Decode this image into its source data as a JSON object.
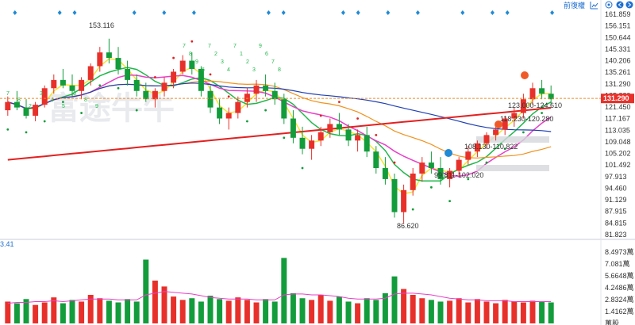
{
  "toolbar": {
    "label": "前復權",
    "icons": [
      "line-chart-icon",
      "gear-icon",
      "prev-icon",
      "next-icon"
    ]
  },
  "colors": {
    "up": "#e8302a",
    "down": "#139c3b",
    "ma_short": "#f5e52c",
    "ma_mid": "#1fb84a",
    "ma_magenta": "#e83fc8",
    "ma_orange": "#f0921e",
    "ma_blue": "#1f3fb3",
    "ma_red_long": "#e32020",
    "sar": "#e32020",
    "sar_low": "#139c3b",
    "price_line": "#f08a24",
    "price_tag": "#e8302a",
    "event_diamond": "#1f8ad6"
  },
  "watermark": "富途牛牛",
  "chart_data": {
    "type": "candlestick",
    "price_axis": {
      "ticks": [
        "161.859",
        "156.151",
        "150.644",
        "145.331",
        "140.206",
        "135.261",
        "131.290",
        "125.889",
        "121.450",
        "117.167",
        "113.035",
        "109.048",
        "105.202",
        "101.492",
        "97.913",
        "94.460",
        "91.129",
        "87.915",
        "84.815",
        "81.823"
      ],
      "ylim": [
        81.823,
        161.859
      ]
    },
    "current_price": "131.290",
    "annotations": {
      "high": "153.116",
      "low": "86.620",
      "zones": [
        "123.000-124.610",
        "118.230-120.280",
        "108.130-110.822",
        "99.811-102.020"
      ]
    },
    "td_counts": {
      "sell": [
        "7",
        "8",
        "9",
        "6",
        "7",
        "2",
        "3",
        "4",
        "7",
        "1",
        "2",
        "3",
        "9",
        "6",
        "7",
        "8"
      ],
      "buy": [
        "7",
        "8",
        "2",
        "3",
        "4",
        "5",
        "6",
        "8",
        "9"
      ]
    },
    "ohlc": [
      [
        127,
        132,
        125,
        130
      ],
      [
        130,
        134,
        127,
        128
      ],
      [
        128,
        131,
        124,
        125
      ],
      [
        125,
        130,
        123,
        129
      ],
      [
        129,
        136,
        128,
        135
      ],
      [
        135,
        140,
        133,
        138
      ],
      [
        138,
        142,
        135,
        136
      ],
      [
        136,
        140,
        132,
        134
      ],
      [
        134,
        139,
        131,
        138
      ],
      [
        138,
        144,
        136,
        143
      ],
      [
        143,
        150,
        141,
        148
      ],
      [
        148,
        153,
        144,
        146
      ],
      [
        146,
        150,
        140,
        142
      ],
      [
        142,
        145,
        136,
        138
      ],
      [
        138,
        140,
        132,
        134
      ],
      [
        134,
        137,
        130,
        131
      ],
      [
        131,
        135,
        128,
        134
      ],
      [
        134,
        139,
        132,
        137
      ],
      [
        137,
        142,
        135,
        141
      ],
      [
        141,
        147,
        140,
        145
      ],
      [
        145,
        148,
        140,
        142
      ],
      [
        142,
        143,
        132,
        134
      ],
      [
        134,
        136,
        126,
        128
      ],
      [
        128,
        131,
        122,
        124
      ],
      [
        124,
        128,
        120,
        126
      ],
      [
        126,
        132,
        124,
        130
      ],
      [
        130,
        135,
        128,
        133
      ],
      [
        133,
        138,
        130,
        136
      ],
      [
        136,
        140,
        132,
        134
      ],
      [
        134,
        137,
        129,
        131
      ],
      [
        131,
        133,
        122,
        124
      ],
      [
        124,
        127,
        115,
        117
      ],
      [
        117,
        121,
        111,
        113
      ],
      [
        113,
        118,
        109,
        116
      ],
      [
        116,
        121,
        114,
        119
      ],
      [
        119,
        124,
        117,
        122
      ],
      [
        122,
        126,
        118,
        120
      ],
      [
        120,
        122,
        114,
        116
      ],
      [
        116,
        120,
        112,
        118
      ],
      [
        118,
        121,
        110,
        112
      ],
      [
        112,
        114,
        104,
        106
      ],
      [
        106,
        110,
        100,
        102
      ],
      [
        102,
        104,
        88,
        90
      ],
      [
        90,
        100,
        86,
        98
      ],
      [
        98,
        106,
        96,
        104
      ],
      [
        104,
        110,
        101,
        108
      ],
      [
        108,
        112,
        104,
        106
      ],
      [
        106,
        110,
        100,
        102
      ],
      [
        102,
        106,
        99,
        105
      ],
      [
        105,
        110,
        103,
        109
      ],
      [
        109,
        114,
        107,
        112
      ],
      [
        112,
        116,
        110,
        115
      ],
      [
        115,
        119,
        113,
        118
      ],
      [
        118,
        122,
        116,
        120
      ],
      [
        120,
        125,
        118,
        124
      ],
      [
        124,
        128,
        121,
        126
      ],
      [
        126,
        133,
        124,
        131
      ],
      [
        131,
        137,
        129,
        135
      ],
      [
        135,
        138,
        131,
        133
      ],
      [
        133,
        136,
        129,
        131
      ]
    ],
    "volume_axis": {
      "ticks": [
        "8.4973萬",
        "7.081萬",
        "5.6648萬",
        "4.2486萬",
        "2.8324萬",
        "1.4162萬",
        "萬股"
      ],
      "ylim": [
        0,
        8.4973
      ]
    },
    "volume_label": "3.41",
    "volume": [
      2.6,
      2.4,
      2.9,
      2.2,
      2.5,
      3.1,
      2.4,
      2.8,
      2.6,
      3.4,
      3.0,
      2.7,
      2.5,
      2.9,
      2.6,
      7.6,
      5.1,
      4.4,
      3.2,
      2.8,
      3.0,
      2.6,
      3.3,
      2.9,
      2.7,
      3.1,
      2.8,
      2.5,
      2.9,
      2.6,
      7.8,
      3.6,
      3.0,
      2.8,
      3.4,
      2.7,
      3.2,
      2.6,
      2.4,
      3.0,
      2.8,
      3.6,
      5.6,
      4.1,
      3.4,
      3.0,
      2.8,
      2.6,
      2.7,
      3.0,
      2.5,
      2.9,
      2.6,
      2.4,
      2.8,
      2.6,
      2.5,
      2.7,
      2.6,
      2.5
    ],
    "volume_ma": [
      2.4,
      2.5,
      2.5,
      2.6,
      2.6,
      2.7,
      2.6,
      2.7,
      2.8,
      2.9,
      2.9,
      2.9,
      2.8,
      2.8,
      2.8,
      3.4,
      3.6,
      3.8,
      3.7,
      3.6,
      3.5,
      3.3,
      3.1,
      3.0,
      2.9,
      2.9,
      2.9,
      2.8,
      2.8,
      2.8,
      3.4,
      3.5,
      3.5,
      3.4,
      3.4,
      3.3,
      3.2,
      3.0,
      2.9,
      2.9,
      2.9,
      3.0,
      3.5,
      3.6,
      3.6,
      3.5,
      3.4,
      3.2,
      3.0,
      2.9,
      2.8,
      2.8,
      2.7,
      2.7,
      2.7,
      2.6,
      2.6,
      2.6,
      2.6,
      2.6
    ]
  }
}
